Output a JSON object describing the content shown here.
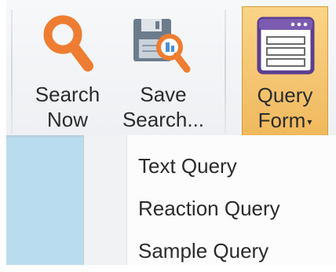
{
  "ribbon": {
    "search_now_label": "Search\nNow",
    "save_search_label": "Save\nSearch...",
    "query_form_label": "Query\nForm",
    "query_form_caret": "▾"
  },
  "menu": {
    "items": [
      {
        "label": "Text Query"
      },
      {
        "label": "Reaction Query"
      },
      {
        "label": "Sample Query"
      }
    ]
  },
  "colors": {
    "accent_orange": "#ee7d31",
    "query_highlight": "#f3c16c",
    "query_icon_purple": "#5a3e8f",
    "side_strip_blue": "#b9dcef"
  },
  "icons": {
    "search_now": "magnifier-icon",
    "save_search": "save-search-icon",
    "query_form": "form-window-icon",
    "dropdown": "caret-down-icon"
  }
}
